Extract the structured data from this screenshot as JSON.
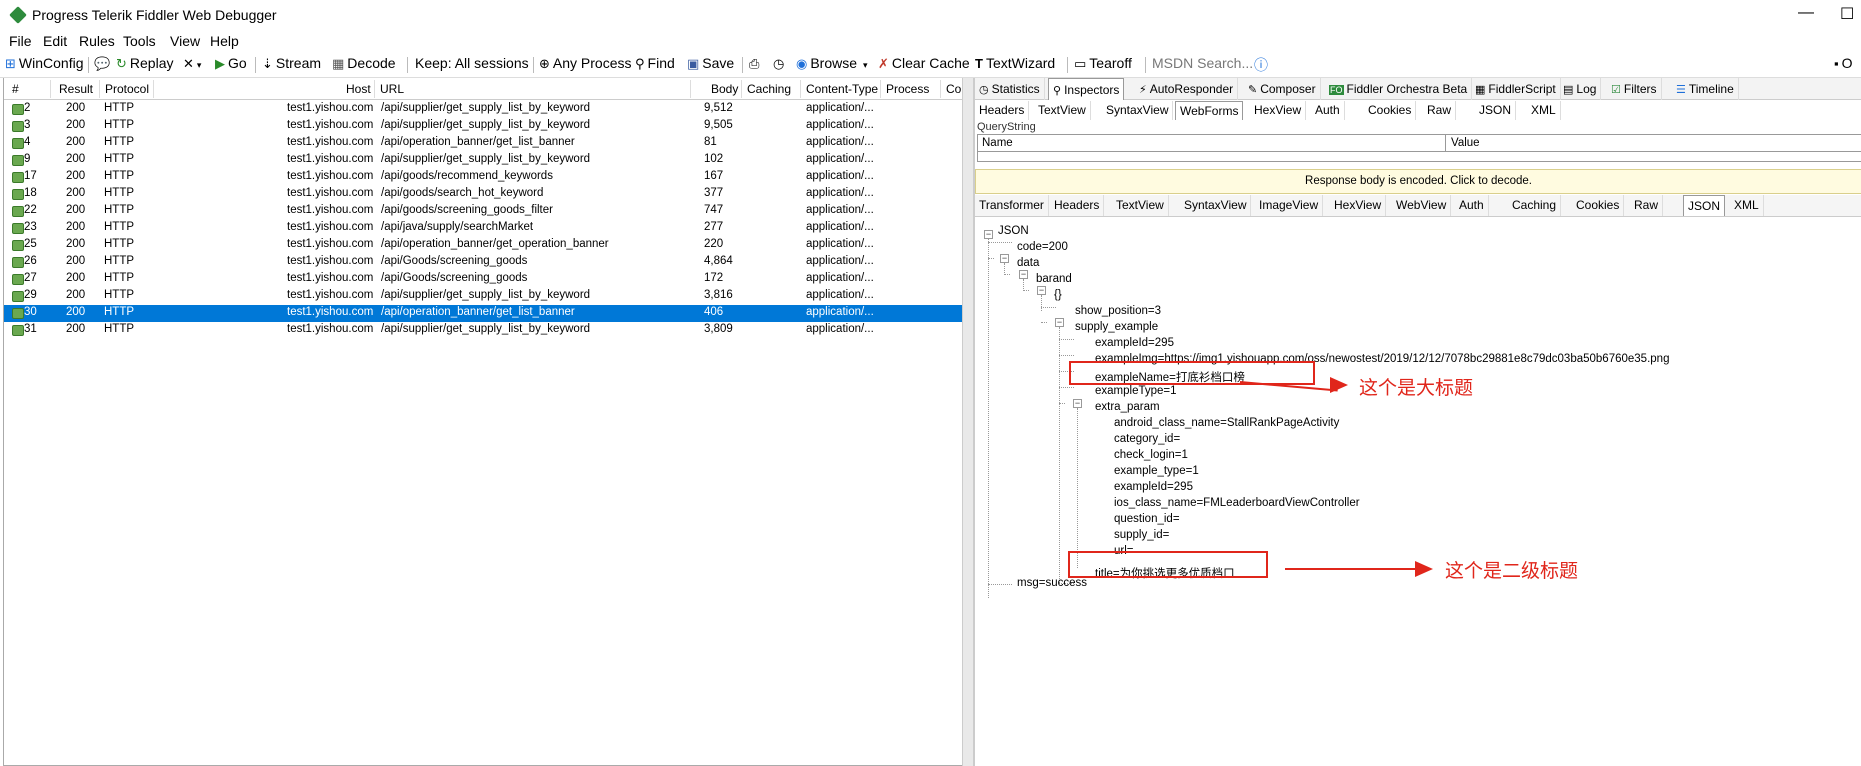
{
  "window": {
    "title": "Progress Telerik Fiddler Web Debugger",
    "min": "—",
    "max": "☐"
  },
  "menu": [
    "File",
    "Edit",
    "Rules",
    "Tools",
    "View",
    "Help"
  ],
  "toolbar": {
    "winconfig": "WinConfig",
    "replay": "Replay",
    "go": "Go",
    "stream": "Stream",
    "decode": "Decode",
    "keep": "Keep: All sessions",
    "process": "Any Process",
    "find": "Find",
    "save": "Save",
    "browse": "Browse",
    "clear_cache": "Clear Cache",
    "textwizard": "TextWizard",
    "tearoff": "Tearoff",
    "msdn_search": "MSDN Search...",
    "online": "O"
  },
  "columns": [
    "#",
    "Result",
    "Protocol",
    "Host",
    "URL",
    "Body",
    "Caching",
    "Content-Type",
    "Process",
    "Cor"
  ],
  "sessions": [
    {
      "id": "2",
      "result": "200",
      "protocol": "HTTP",
      "host": "test1.yishou.com",
      "url": "/api/supplier/get_supply_list_by_keyword",
      "body": "9,512",
      "ctype": "application/..."
    },
    {
      "id": "3",
      "result": "200",
      "protocol": "HTTP",
      "host": "test1.yishou.com",
      "url": "/api/supplier/get_supply_list_by_keyword",
      "body": "9,505",
      "ctype": "application/..."
    },
    {
      "id": "4",
      "result": "200",
      "protocol": "HTTP",
      "host": "test1.yishou.com",
      "url": "/api/operation_banner/get_list_banner",
      "body": "81",
      "ctype": "application/..."
    },
    {
      "id": "9",
      "result": "200",
      "protocol": "HTTP",
      "host": "test1.yishou.com",
      "url": "/api/supplier/get_supply_list_by_keyword",
      "body": "102",
      "ctype": "application/..."
    },
    {
      "id": "17",
      "result": "200",
      "protocol": "HTTP",
      "host": "test1.yishou.com",
      "url": "/api/goods/recommend_keywords",
      "body": "167",
      "ctype": "application/..."
    },
    {
      "id": "18",
      "result": "200",
      "protocol": "HTTP",
      "host": "test1.yishou.com",
      "url": "/api/goods/search_hot_keyword",
      "body": "377",
      "ctype": "application/..."
    },
    {
      "id": "22",
      "result": "200",
      "protocol": "HTTP",
      "host": "test1.yishou.com",
      "url": "/api/goods/screening_goods_filter",
      "body": "747",
      "ctype": "application/..."
    },
    {
      "id": "23",
      "result": "200",
      "protocol": "HTTP",
      "host": "test1.yishou.com",
      "url": "/api/java/supply/searchMarket",
      "body": "277",
      "ctype": "application/..."
    },
    {
      "id": "25",
      "result": "200",
      "protocol": "HTTP",
      "host": "test1.yishou.com",
      "url": "/api/operation_banner/get_operation_banner",
      "body": "220",
      "ctype": "application/..."
    },
    {
      "id": "26",
      "result": "200",
      "protocol": "HTTP",
      "host": "test1.yishou.com",
      "url": "/api/Goods/screening_goods",
      "body": "4,864",
      "ctype": "application/..."
    },
    {
      "id": "27",
      "result": "200",
      "protocol": "HTTP",
      "host": "test1.yishou.com",
      "url": "/api/Goods/screening_goods",
      "body": "172",
      "ctype": "application/..."
    },
    {
      "id": "29",
      "result": "200",
      "protocol": "HTTP",
      "host": "test1.yishou.com",
      "url": "/api/supplier/get_supply_list_by_keyword",
      "body": "3,816",
      "ctype": "application/..."
    },
    {
      "id": "30",
      "result": "200",
      "protocol": "HTTP",
      "host": "test1.yishou.com",
      "url": "/api/operation_banner/get_list_banner",
      "body": "406",
      "ctype": "application/...",
      "selected": true
    },
    {
      "id": "31",
      "result": "200",
      "protocol": "HTTP",
      "host": "test1.yishou.com",
      "url": "/api/supplier/get_supply_list_by_keyword",
      "body": "3,809",
      "ctype": "application/..."
    }
  ],
  "main_tabs": [
    "Statistics",
    "Inspectors",
    "AutoResponder",
    "Composer",
    "Fiddler Orchestra Beta",
    "FiddlerScript",
    "Log",
    "Filters",
    "Timeline"
  ],
  "request_tabs": [
    "Headers",
    "TextView",
    "SyntaxView",
    "WebForms",
    "HexView",
    "Auth",
    "Cookies",
    "Raw",
    "JSON",
    "XML"
  ],
  "querystring": {
    "label": "QueryString",
    "name_col": "Name",
    "value_col": "Value"
  },
  "encoded_notice": "Response body is encoded. Click to decode.",
  "response_tabs": [
    "Transformer",
    "Headers",
    "TextView",
    "SyntaxView",
    "ImageView",
    "HexView",
    "WebView",
    "Auth",
    "Caching",
    "Cookies",
    "Raw",
    "JSON",
    "XML"
  ],
  "tree": [
    "JSON",
    "code=200",
    "data",
    "barand",
    "{}",
    "show_position=3",
    "supply_example",
    "exampleId=295",
    "exampleImg=https://img1.yishouapp.com/oss/newostest/2019/12/12/7078bc29881e8c79dc03ba50b6760e35.png",
    "exampleName=打底衫档口榜",
    "exampleType=1",
    "extra_param",
    "android_class_name=StallRankPageActivity",
    "category_id=",
    "check_login=1",
    "example_type=1",
    "exampleId=295",
    "ios_class_name=FMLeaderboardViewController",
    "question_id=",
    "supply_id=",
    "url=",
    "title=为你挑选更多优质档口",
    "msg=success"
  ],
  "annotations": {
    "main_title": "这个是大标题",
    "sub_title": "这个是二级标题"
  },
  "colors": {
    "selection": "#0078d7",
    "annotation": "#e0261b",
    "notice_bg": "#fffbe0"
  }
}
